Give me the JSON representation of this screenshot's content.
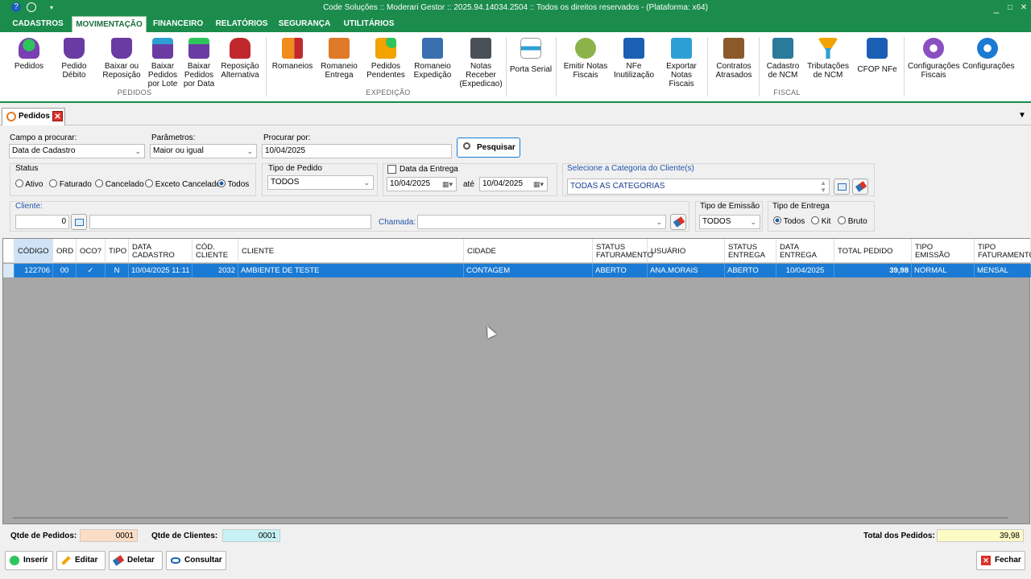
{
  "titlebar": {
    "title": "Code Soluções :: Moderari Gestor :: 2025.94.14034.2504 :: Todos os direitos reservados - (Plataforma: x64)",
    "help_icon": "?",
    "min": "_",
    "max": "□",
    "close": "✕"
  },
  "menu": [
    "CADASTROS",
    "MOVIMENTAÇÃO",
    "FINANCEIRO",
    "RELATÓRIOS",
    "SEGURANÇA",
    "UTILITÁRIOS"
  ],
  "ribbon": {
    "pedidos": "Pedidos",
    "pedido_debito": "Pedido\nDébito",
    "baixar_reposicao": "Baixar ou\nReposição",
    "baixar_lote": "Baixar\nPedidos\npor Lote",
    "baixar_data": "Baixar\nPedidos\npor Data",
    "reposicao_alt": "Reposição\nAlternativa",
    "group_pedidos": "PEDIDOS",
    "romaneios": "Romaneios",
    "romaneio_entrega": "Romaneio\nEntrega",
    "pedidos_pendentes": "Pedidos\nPendentes",
    "romaneio_expedicao": "Romaneio\nExpedição",
    "notas_receber": "Notas\nReceber\n(Expedicao)",
    "group_expedicao": "EXPEDIÇÃO",
    "porta_serial": "Porta Serial",
    "emitir_notas": "Emitir Notas\nFiscais",
    "nfe_inutilizacao": "NFe\nInutilização",
    "exportar_notas": "Exportar\nNotas\nFiscais",
    "contratos_atrasados": "Contratos\nAtrasados",
    "cadastro_ncm": "Cadastro\nde NCM",
    "tributacoes_ncm": "Tributações\nde NCM",
    "cfop_nfe": "CFOP NFe",
    "group_fiscal": "FISCAL",
    "config_fiscais": "Configurações\nFiscais",
    "configuracoes": "Configurações"
  },
  "tab": {
    "label": "Pedidos",
    "close": "✕"
  },
  "filters": {
    "campo_label": "Campo a procurar:",
    "campo_value": "Data de Cadastro",
    "parametros_label": "Parâmetros:",
    "parametros_value": "Maior ou igual",
    "procurar_label": "Procurar por:",
    "procurar_value": "10/04/2025",
    "pesquisar": "Pesquisar",
    "status_label": "Status",
    "status_options": [
      "Ativo",
      "Faturado",
      "Cancelado",
      "Exceto Cancelado",
      "Todos"
    ],
    "tipo_pedido_label": "Tipo de Pedido",
    "tipo_pedido_value": "TODOS",
    "data_entrega_label": "Data da Entrega",
    "data_de": "10/04/2025",
    "ate": "até",
    "data_ate": "10/04/2025",
    "categoria_label": "Selecione a Categoria do Cliente(s)",
    "categoria_value": "TODAS AS CATEGORIAS",
    "cliente_label": "Cliente:",
    "cliente_code": "0",
    "chamada_label": "Chamada:",
    "tipo_emissao_label": "Tipo de Emissão",
    "tipo_emissao_value": "TODOS",
    "tipo_entrega_label": "Tipo de Entrega",
    "tipo_entrega_options": [
      "Todos",
      "Kit",
      "Bruto"
    ]
  },
  "grid": {
    "columns": [
      "CÓDIGO",
      "ORD",
      "OCO?",
      "TIPO",
      "DATA\nCADASTRO",
      "CÓD.\nCLIENTE",
      "CLIENTE",
      "CIDADE",
      "STATUS\nFATURAMENTO",
      "USUÁRIO",
      "STATUS\nENTREGA",
      "DATA\nENTREGA",
      "TOTAL PEDIDO",
      "TIPO\nEMISSÃO",
      "TIPO\nFATURAMENTO"
    ],
    "rows": [
      [
        "122706",
        "00",
        "✓",
        "N",
        "10/04/2025 11:11",
        "2032",
        "AMBIENTE DE TESTE",
        "CONTAGEM",
        "ABERTO",
        "ANA.MORAIS",
        "ABERTO",
        "10/04/2025",
        "39,98",
        "NORMAL",
        "MENSAL"
      ]
    ]
  },
  "totals": {
    "qtde_pedidos_label": "Qtde de Pedidos:",
    "qtde_pedidos": "0001",
    "qtde_clientes_label": "Qtde de Clientes:",
    "qtde_clientes": "0001",
    "total_label": "Total dos Pedidos:",
    "total": "39,98"
  },
  "actions": {
    "inserir": "Inserir",
    "editar": "Editar",
    "deletar": "Deletar",
    "consultar": "Consultar",
    "fechar": "Fechar"
  },
  "colors": {
    "brand": "#1b8c4c",
    "selection": "#1a7ad4"
  }
}
